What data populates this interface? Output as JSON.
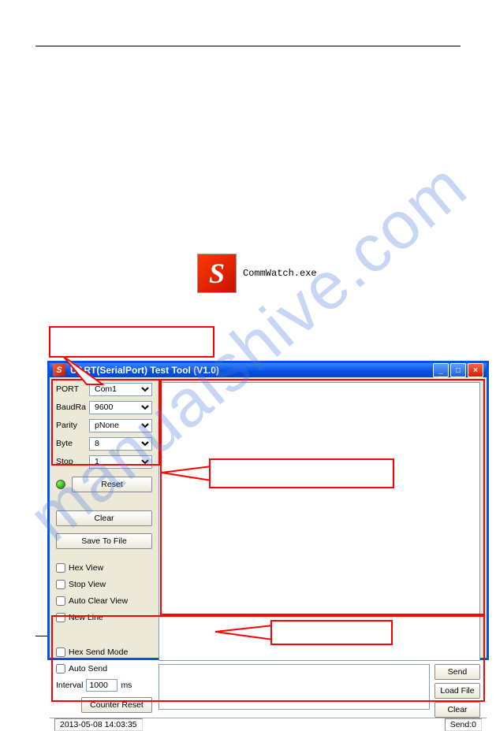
{
  "exe": {
    "icon_letter": "S",
    "label": "CommWatch.exe"
  },
  "window": {
    "title": "UART(SerialPort) Test Tool (V1.0)",
    "icon_letter": "S"
  },
  "config": {
    "port_label": "PORT",
    "port_value": "Com1",
    "baud_label": "BaudRa",
    "baud_value": "9600",
    "parity_label": "Parity",
    "parity_value": "pNone",
    "byte_label": "Byte",
    "byte_value": "8",
    "stop_label": "Stop",
    "stop_value": "1"
  },
  "buttons": {
    "reset": "Reset",
    "clear": "Clear",
    "save_to_file": "Save To File",
    "load_file": "Load File",
    "counter_reset": "Counter Reset",
    "clear2": "Clear",
    "send": "Send"
  },
  "checks": {
    "hex_view": "Hex View",
    "stop_view": "Stop View",
    "auto_clear_view": "Auto Clear View",
    "new_line": "New Line",
    "hex_send_mode": "Hex Send Mode",
    "auto_send": "Auto Send"
  },
  "interval": {
    "label": "Interval",
    "value": "1000",
    "unit": "ms"
  },
  "statusbar": {
    "datetime": "2013-05-08 14:03:35",
    "send_count": "Send:0"
  },
  "watermark": "manualshive.com"
}
